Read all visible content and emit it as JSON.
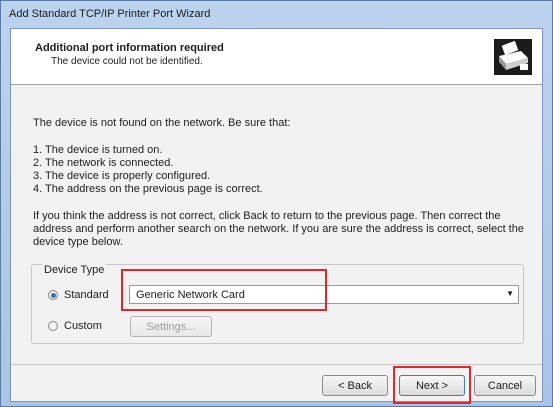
{
  "window": {
    "title": "Add Standard TCP/IP Printer Port Wizard"
  },
  "header": {
    "title": "Additional port information required",
    "subtitle": "The device could not be identified.",
    "icon": "printer-network-icon"
  },
  "body": {
    "intro": "The device is not found on the network.  Be sure that:",
    "checklist": [
      "1.  The device is turned on.",
      "2.  The network is connected.",
      "3.  The device is properly configured.",
      "4.  The address on the previous page is correct."
    ],
    "instructions": "If you think the address is not correct, click Back to return to the previous page.  Then correct the address and perform another search on the network.  If you are sure the address is correct, select the device type below."
  },
  "device_type": {
    "legend": "Device Type",
    "standard_label": "Standard",
    "standard_selected": true,
    "standard_value": "Generic Network Card",
    "custom_label": "Custom",
    "settings_label": "Settings..."
  },
  "footer": {
    "back_label": "< Back",
    "next_label": "Next >",
    "cancel_label": "Cancel"
  },
  "highlight_color": "#e5242b"
}
